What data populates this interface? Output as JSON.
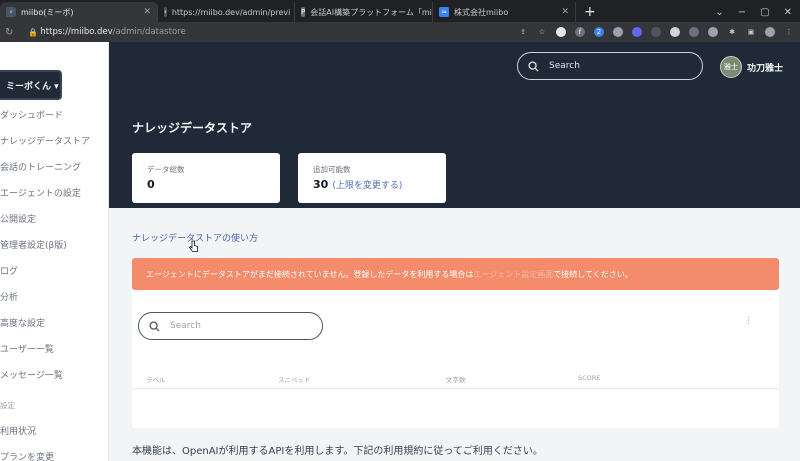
{
  "tabs": [
    {
      "label": "miibo(ミーボ)",
      "active": true
    },
    {
      "label": "https://miibo.dev/admin/previ",
      "active": false
    },
    {
      "label": "会話AI構築プラットフォーム「mii",
      "active": false
    },
    {
      "label": "株式会社miibo",
      "active": false
    }
  ],
  "url": {
    "host": "https://miibo.dev",
    "path": "/admin/datastore"
  },
  "sidebar": {
    "brand": "ミーボくん ▾",
    "items": [
      "ダッシュボード",
      "ナレッジデータストア",
      "会話のトレーニング",
      "エージェントの設定",
      "公開設定",
      "管理者設定(β版)",
      "ログ",
      "分析",
      "高度な設定",
      "ユーザー一覧",
      "メッセージ一覧"
    ],
    "section": "設定",
    "section_items": [
      "利用状況",
      "プランを変更"
    ]
  },
  "header": {
    "search_placeholder": "Search",
    "avatar_text": "雅士",
    "username": "功刀雅士"
  },
  "page": {
    "title": "ナレッジデータストア",
    "card_count_label": "データ総数",
    "card_count_value": "0",
    "card_limit_label": "追加可能数",
    "card_limit_value": "30",
    "card_limit_link": "(上限を変更する)",
    "howto_link": "ナレッジデータストアの使い方",
    "alert_text": "エージェントにデータストアがまだ接続されていません。登録したデータを利用する場合は",
    "alert_link": "エージェント設定画面",
    "alert_suffix": "で接続してください。",
    "table_search_placeholder": "Search",
    "kebab": "⋮",
    "columns": [
      "ラベル",
      "スニペッド",
      "文字数",
      "SCORE"
    ],
    "footer_note": "本機能は、OpenAIが利用するAPIを利用します。下記の利用規約に従ってご利用ください。"
  },
  "colors": {
    "header_bg": "#1f2937",
    "alert_bg": "#f48c6b",
    "link": "#4b5fa8"
  }
}
